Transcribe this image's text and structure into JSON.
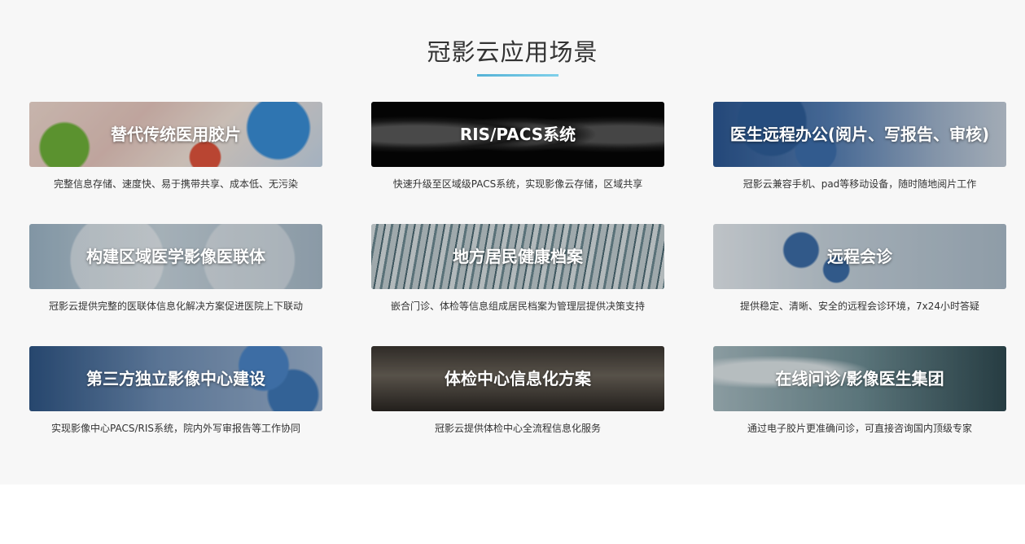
{
  "section_title": "冠影云应用场景",
  "cards": [
    {
      "title": "替代传统医用胶片",
      "desc": "完整信息存储、速度快、易于携带共享、成本低、无污染"
    },
    {
      "title": "RIS/PACS系统",
      "desc": "快速升级至区域级PACS系统，实现影像云存储，区域共享"
    },
    {
      "title": "医生远程办公(阅片、写报告、审核)",
      "desc": "冠影云兼容手机、pad等移动设备，随时随地阅片工作"
    },
    {
      "title": "构建区域医学影像医联体",
      "desc": "冠影云提供完整的医联体信息化解决方案促进医院上下联动"
    },
    {
      "title": "地方居民健康档案",
      "desc": "嵌合门诊、体检等信息组成居民档案为管理层提供决策支持"
    },
    {
      "title": "远程会诊",
      "desc": "提供稳定、清晰、安全的远程会诊环境，7x24小时答疑"
    },
    {
      "title": "第三方独立影像中心建设",
      "desc": "实现影像中心PACS/RIS系统，院内外写审报告等工作协同"
    },
    {
      "title": "体检中心信息化方案",
      "desc": "冠影云提供体检中心全流程信息化服务"
    },
    {
      "title": "在线问诊/影像医生集团",
      "desc": "通过电子胶片更准确问诊，可直接咨询国内顶级专家"
    }
  ],
  "colors": {
    "section_bg": "#f7f7f7",
    "accent": "#55b2d6",
    "title_text": "#333333"
  }
}
